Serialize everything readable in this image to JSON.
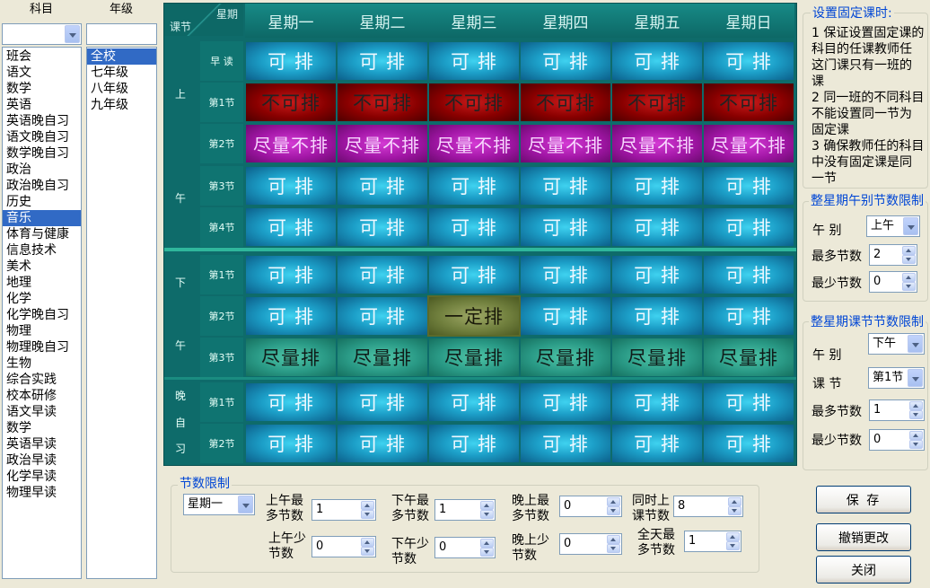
{
  "subject_panel": {
    "header": "科目",
    "combo_value": "",
    "items": [
      "班会",
      "语文",
      "数学",
      "英语",
      "英语晚自习",
      "语文晚自习",
      "数学晚自习",
      "政治",
      "政治晚自习",
      "历史",
      "音乐",
      "体育与健康",
      "信息技术",
      "美术",
      "地理",
      "化学",
      "化学晚自习",
      "物理",
      "物理晚自习",
      "生物",
      "综合实践",
      "校本研修",
      "语文早读",
      "数学",
      "英语早读",
      "政治早读",
      "化学早读",
      "物理早读"
    ],
    "selected": "音乐"
  },
  "grade_panel": {
    "header": "年级",
    "combo_value": "",
    "items": [
      "全校",
      "七年级",
      "八年级",
      "九年级"
    ],
    "selected": "全校"
  },
  "grid": {
    "corner_top": "星期",
    "corner_bottom": "课节",
    "days": [
      "星期一",
      "星期二",
      "星期三",
      "星期四",
      "星期五",
      "星期日"
    ],
    "sections": {
      "morning_char1": "上",
      "morning_char2": "午",
      "afternoon_char1": "下",
      "afternoon_char2": "午",
      "evening_chars": [
        "晚",
        "自",
        "习"
      ]
    },
    "rows": [
      {
        "label": "早 读",
        "cells": [
          "可 排",
          "可 排",
          "可 排",
          "可 排",
          "可 排",
          "可 排"
        ],
        "kind": "ok"
      },
      {
        "label": "第1节",
        "cells": [
          "不可排",
          "不可排",
          "不可排",
          "不可排",
          "不可排",
          "不可排"
        ],
        "kind": "no"
      },
      {
        "label": "第2节",
        "cells": [
          "尽量不排",
          "尽量不排",
          "尽量不排",
          "尽量不排",
          "尽量不排",
          "尽量不排"
        ],
        "kind": "avoid"
      },
      {
        "label": "第3节",
        "cells": [
          "可 排",
          "可 排",
          "可 排",
          "可 排",
          "可 排",
          "可 排"
        ],
        "kind": "ok"
      },
      {
        "label": "第4节",
        "cells": [
          "可 排",
          "可 排",
          "可 排",
          "可 排",
          "可 排",
          "可 排"
        ],
        "kind": "ok"
      },
      {
        "label": "第1节",
        "cells": [
          "可 排",
          "可 排",
          "可 排",
          "可 排",
          "可 排",
          "可 排"
        ],
        "kind": "ok"
      },
      {
        "label": "第2节",
        "cells": [
          "可 排",
          "可 排",
          "一定排",
          "可 排",
          "可 排",
          "可 排"
        ],
        "kind": "ok"
      },
      {
        "label": "第3节",
        "cells": [
          "尽量排",
          "尽量排",
          "尽量排",
          "尽量排",
          "尽量排",
          "尽量排"
        ],
        "kind": "pref"
      },
      {
        "label": "第1节",
        "cells": [
          "可 排",
          "可 排",
          "可 排",
          "可 排",
          "可 排",
          "可 排"
        ],
        "kind": "ok"
      },
      {
        "label": "第2节",
        "cells": [
          "可 排",
          "可 排",
          "可 排",
          "可 排",
          "可 排",
          "可 排"
        ],
        "kind": "ok"
      }
    ]
  },
  "fixed_panel": {
    "title": "设置固定课时:",
    "lines": [
      "1 保证设置固定课的",
      "科目的任课教师任",
      "这门课只有一班的",
      "课",
      "2 同一班的不同科目",
      "不能设置同一节为",
      "固定课",
      "3 确保教师任的科目",
      "中没有固定课是同",
      "一节"
    ]
  },
  "week_half_limit": {
    "title": "整星期午别节数限制",
    "half_label": "午 别",
    "half_value": "上午",
    "max_label": "最多节数",
    "max_value": "2",
    "min_label": "最少节数",
    "min_value": "0"
  },
  "week_period_limit": {
    "title": "整星期课节节数限制",
    "half_label": "午 别",
    "half_value": "下午",
    "period_label": "课 节",
    "period_value": "第1节",
    "max_label": "最多节数",
    "max_value": "1",
    "min_label": "最少节数",
    "min_value": "0"
  },
  "count_limit": {
    "title": "节数限制",
    "day_value": "星期一",
    "am_max_label": "上午最多节数",
    "am_max_value": "1",
    "am_min_label": "上午少节数",
    "am_min_value": "0",
    "pm_max_label": "下午最多节数",
    "pm_max_value": "1",
    "pm_min_label": "下午少节数",
    "pm_min_value": "0",
    "ev_max_label": "晚上最多节数",
    "ev_max_value": "0",
    "ev_min_label": "晚上少节数",
    "ev_min_value": "0",
    "same_label": "同时上课节数",
    "same_value": "8",
    "day_max_label": "全天最多节数",
    "day_max_value": "1"
  },
  "buttons": {
    "save": "保 存",
    "undo": "撤销更改",
    "close": "关闭"
  }
}
